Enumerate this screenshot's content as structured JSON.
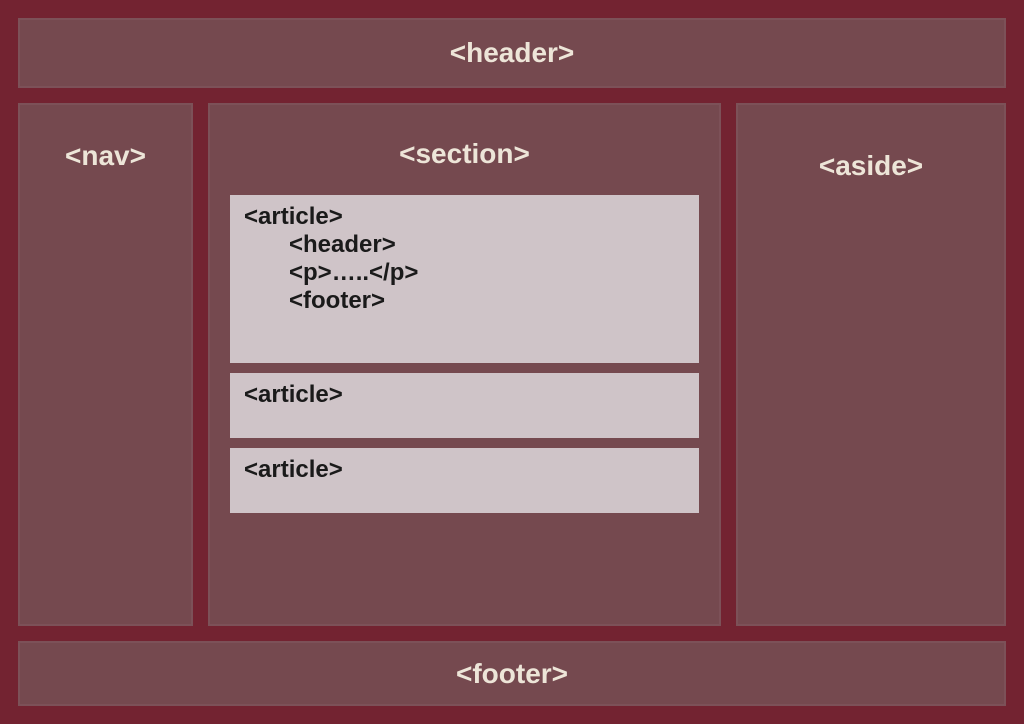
{
  "header": {
    "label": "<header>"
  },
  "nav": {
    "label": "<nav>"
  },
  "section": {
    "label": "<section>",
    "articles": [
      {
        "title": "<article>",
        "lines": [
          "<header>",
          "<p>…..</p>",
          "<footer>"
        ]
      },
      {
        "title": "<article>"
      },
      {
        "title": "<article>"
      }
    ]
  },
  "aside": {
    "label": "<aside>"
  },
  "footer": {
    "label": "<footer>"
  }
}
